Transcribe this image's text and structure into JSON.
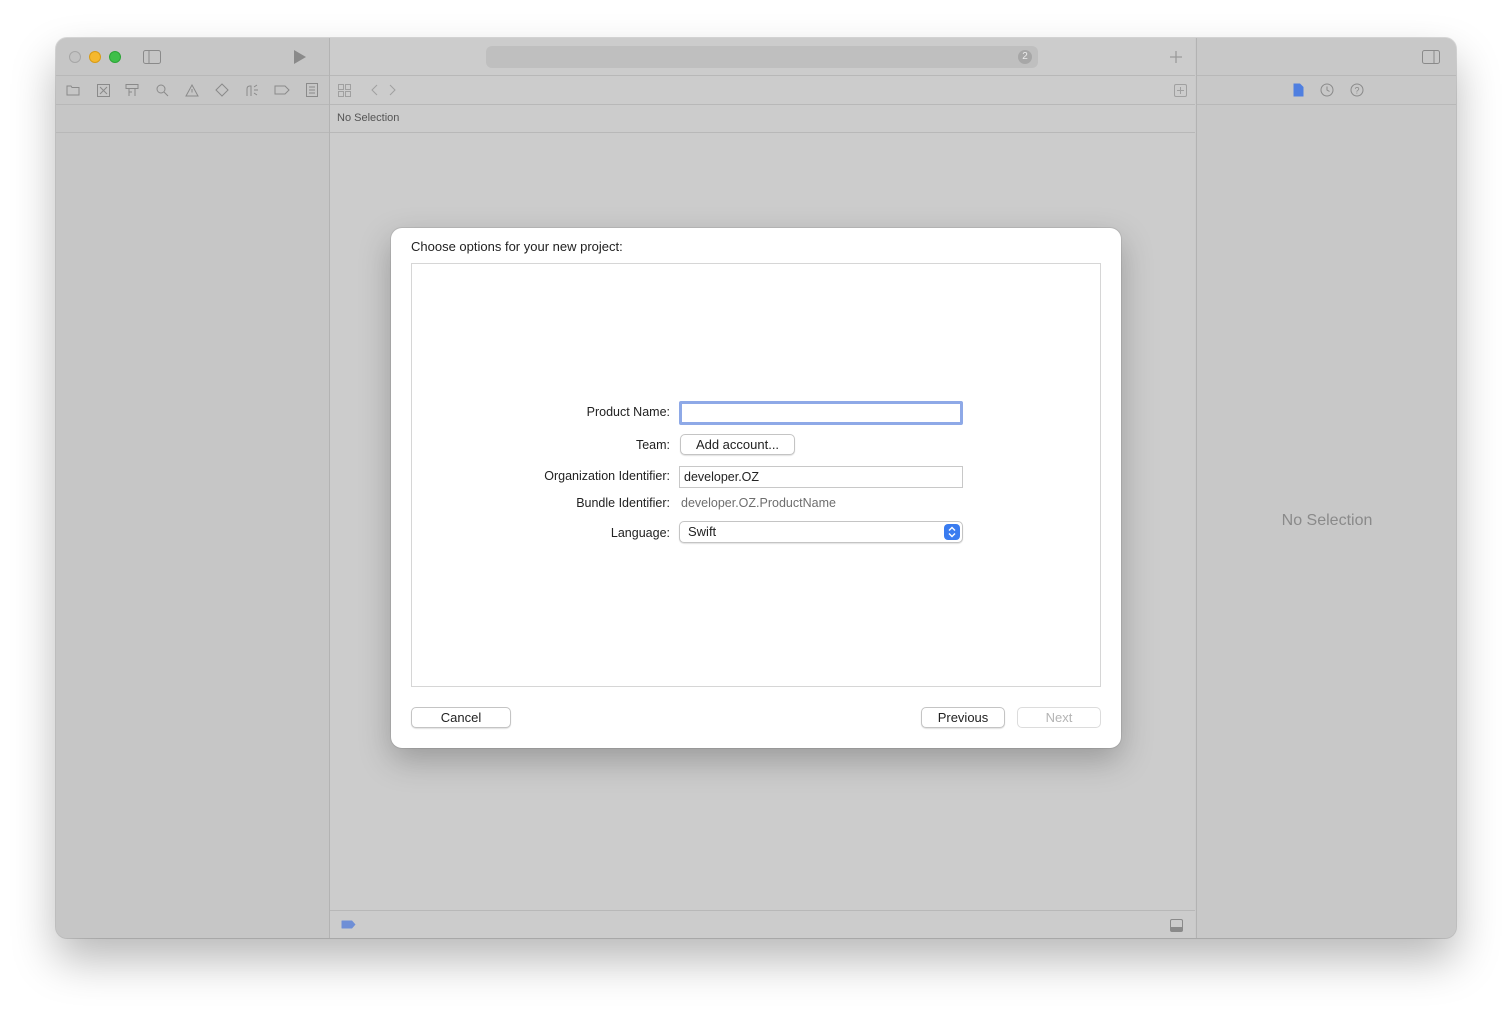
{
  "toolbar": {
    "activity_badge": "2"
  },
  "navigator_icons": [
    "folder-icon",
    "source-control-icon",
    "hierarchy-icon",
    "search-icon",
    "warning-icon",
    "test-diamond-icon",
    "debug-gauge-icon",
    "breakpoint-icon",
    "report-icon"
  ],
  "editor": {
    "jump_bar_label": "No Selection"
  },
  "inspector": {
    "empty_label": "No Selection",
    "icons": [
      "file-inspector-icon",
      "history-icon",
      "help-icon"
    ]
  },
  "sheet": {
    "title": "Choose options for your new project:",
    "form": {
      "product_name_label": "Product Name:",
      "product_name_value": "",
      "team_label": "Team:",
      "team_button": "Add account...",
      "org_id_label": "Organization Identifier:",
      "org_id_value": "developer.OZ",
      "bundle_id_label": "Bundle Identifier:",
      "bundle_id_value": "developer.OZ.ProductName",
      "language_label": "Language:",
      "language_value": "Swift"
    },
    "buttons": {
      "cancel": "Cancel",
      "previous": "Previous",
      "next": "Next"
    }
  },
  "colors": {
    "accent": "#3a7cf0",
    "focus_ring": "#8ea9e7"
  }
}
